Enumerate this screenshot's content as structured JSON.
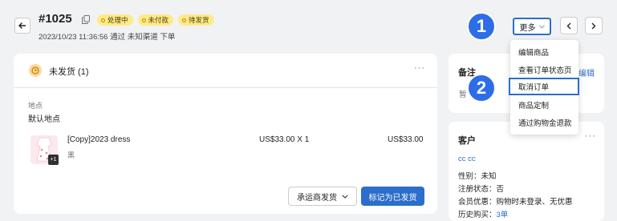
{
  "header": {
    "order_id": "#1025",
    "badges": [
      "处理中",
      "未付款",
      "待发货"
    ],
    "meta": "2023/10/23 11:36:56 通过 未知渠道 下单",
    "more_label": "更多"
  },
  "markers": [
    "1",
    "2"
  ],
  "menu": {
    "items": [
      "编辑商品",
      "查看订单状态页",
      "取消订单",
      "商品定制",
      "通过购物金退款"
    ]
  },
  "fulfillment": {
    "title": "未发货 (1)",
    "location_label": "地点",
    "location_value": "默认地点",
    "product_name": "[Copy]2023 dress",
    "product_variant": "黑",
    "unit_price": "US$33.00 X 1",
    "total": "US$33.00",
    "thumb_count": "+1",
    "carrier_button": "承运商发货",
    "mark_button": "标记为已发货"
  },
  "notes": {
    "title": "备注",
    "edit_link": "编辑",
    "placeholder": "暂"
  },
  "customer": {
    "title": "客户",
    "name": "cc cc",
    "gender_label": "性别：",
    "gender": "未知",
    "reg_label": "注册状态：",
    "reg": "否",
    "discount_label": "会员优惠：",
    "discount": "购物时未登录、无优惠",
    "history_label": "历史购买：",
    "history": "3单"
  },
  "colors": {
    "accent": "#2c6ecb",
    "marker": "#2d6ee8",
    "badge": "#ffea8a"
  }
}
